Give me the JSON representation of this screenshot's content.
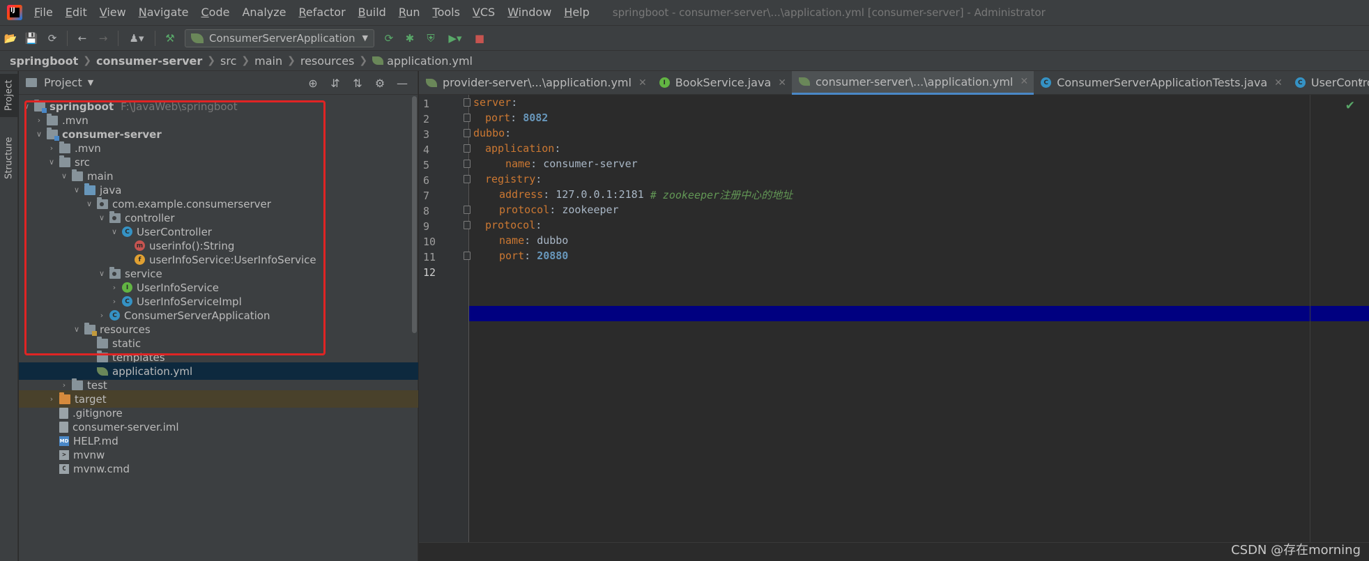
{
  "menubar": {
    "items": [
      {
        "u": "F",
        "rest": "ile"
      },
      {
        "u": "E",
        "rest": "dit"
      },
      {
        "u": "V",
        "rest": "iew"
      },
      {
        "u": "N",
        "rest": "avigate"
      },
      {
        "u": "C",
        "rest": "ode"
      },
      {
        "u": "",
        "rest": "Analyze"
      },
      {
        "u": "R",
        "rest": "efactor"
      },
      {
        "u": "B",
        "rest": "uild"
      },
      {
        "u": "R",
        "rest": "un"
      },
      {
        "u": "T",
        "rest": "ools"
      },
      {
        "u": "V",
        "rest": "CS"
      },
      {
        "u": "W",
        "rest": "indow"
      },
      {
        "u": "H",
        "rest": "elp"
      }
    ],
    "window_title": "springboot - consumer-server\\...\\application.yml [consumer-server] - Administrator"
  },
  "toolbar": {
    "run_config": "ConsumerServerApplication"
  },
  "breadcrumbs": [
    "springboot",
    "consumer-server",
    "src",
    "main",
    "resources",
    "application.yml"
  ],
  "toolstrip": {
    "project_tab": "Project",
    "structure_tab": "Structure"
  },
  "project_panel": {
    "title": "Project",
    "tree": [
      {
        "label": "springboot",
        "path": "F:\\JavaWeb\\springboot"
      },
      {
        "label": ".mvn"
      },
      {
        "label": "consumer-server"
      },
      {
        "label": ".mvn"
      },
      {
        "label": "src"
      },
      {
        "label": "main"
      },
      {
        "label": "java"
      },
      {
        "label": "com.example.consumerserver"
      },
      {
        "label": "controller"
      },
      {
        "label": "UserController"
      },
      {
        "label": "userinfo():String"
      },
      {
        "label": "userInfoService:UserInfoService"
      },
      {
        "label": "service"
      },
      {
        "label": "UserInfoService"
      },
      {
        "label": "UserInfoServiceImpl"
      },
      {
        "label": "ConsumerServerApplication"
      },
      {
        "label": "resources"
      },
      {
        "label": "static"
      },
      {
        "label": "templates"
      },
      {
        "label": "application.yml"
      },
      {
        "label": "test"
      },
      {
        "label": "target"
      },
      {
        "label": ".gitignore"
      },
      {
        "label": "consumer-server.iml"
      },
      {
        "label": "HELP.md"
      },
      {
        "label": "mvnw"
      },
      {
        "label": "mvnw.cmd"
      }
    ]
  },
  "editor_tabs": [
    {
      "label": "provider-server\\...\\application.yml"
    },
    {
      "label": "BookService.java"
    },
    {
      "label": "consumer-server\\...\\application.yml"
    },
    {
      "label": "ConsumerServerApplicationTests.java"
    },
    {
      "label": "UserController.java"
    }
  ],
  "editor": {
    "line_numbers": [
      "1",
      "2",
      "3",
      "4",
      "5",
      "6",
      "7",
      "8",
      "9",
      "10",
      "11",
      "12"
    ],
    "lines": [
      {
        "key": "server",
        "sep": ":"
      },
      {
        "key": "port",
        "sep": ": ",
        "num": "8082"
      },
      {
        "key": "dubbo",
        "sep": ":"
      },
      {
        "key": "application",
        "sep": ":"
      },
      {
        "key": "name",
        "sep": ": ",
        "val": "consumer-server"
      },
      {
        "key": "registry",
        "sep": ":"
      },
      {
        "key": "address",
        "sep": ": ",
        "val": "127.0.0.1:2181 ",
        "comment": "# zookeeper注册中心的地址"
      },
      {
        "key": "protocol",
        "sep": ": ",
        "val": "zookeeper"
      },
      {
        "key": "protocol",
        "sep": ":"
      },
      {
        "key": "name",
        "sep": ": ",
        "val": "dubbo"
      },
      {
        "key": "port",
        "sep": ": ",
        "num": "20880"
      }
    ]
  },
  "watermark": "CSDN @存在morning"
}
